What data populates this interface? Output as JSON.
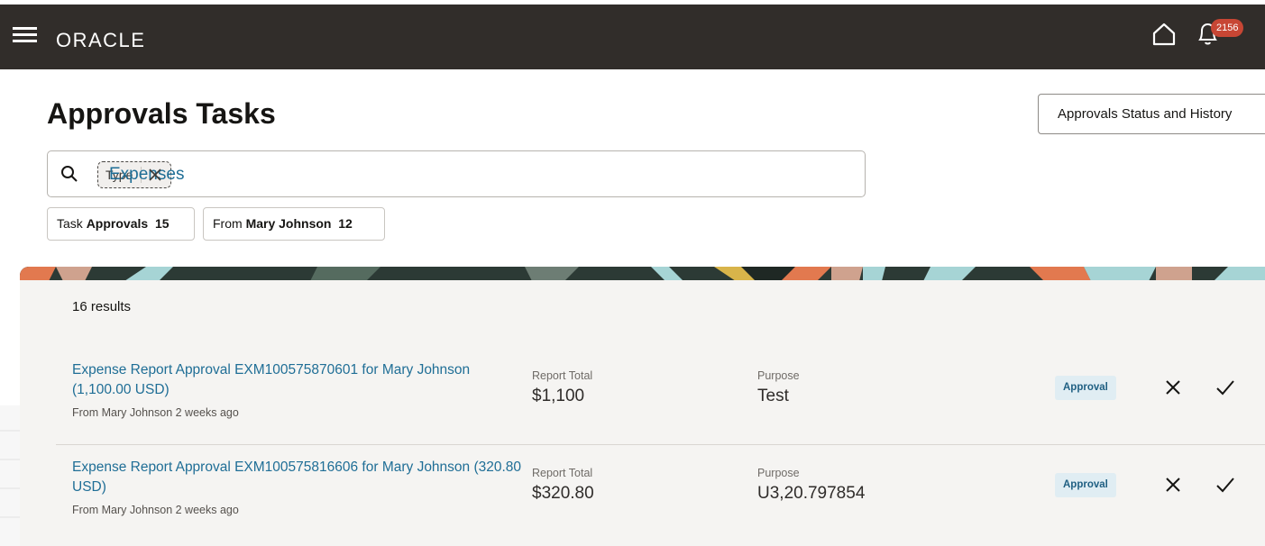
{
  "header": {
    "logo": "ORACLE",
    "notification_count": "2156",
    "icons": {
      "menu": "hamburger-menu-icon",
      "home": "home-icon",
      "notifications": "bell-icon"
    }
  },
  "page": {
    "title": "Approvals Tasks",
    "status_history_button": "Approvals Status and History"
  },
  "search": {
    "chip_type": "Type",
    "chip_value": "Expenses"
  },
  "filters": [
    {
      "label": "Task",
      "value": "Approvals",
      "count": "15"
    },
    {
      "label": "From",
      "value": "Mary Johnson",
      "count": "12"
    }
  ],
  "results": {
    "count_label": "16 results",
    "total_label": "Report Total",
    "purpose_label": "Purpose",
    "items": [
      {
        "title": "Expense Report Approval EXM100575870601 for Mary Johnson (1,100.00 USD)",
        "subtitle": "From Mary Johnson 2 weeks ago",
        "report_total": "$1,100",
        "purpose": "Test",
        "status": "Approval"
      },
      {
        "title": "Expense Report Approval EXM100575816606 for Mary Johnson (320.80 USD)",
        "subtitle": "From Mary Johnson 2 weeks ago",
        "report_total": "$320.80",
        "purpose": "U3,20.797854",
        "status": "Approval"
      }
    ]
  },
  "colors": {
    "header_bg": "#312d2a",
    "badge": "#c74634",
    "link": "#1f6e96",
    "panel_bg": "#f5f4f2",
    "status_pill_bg": "#e0edf3"
  }
}
